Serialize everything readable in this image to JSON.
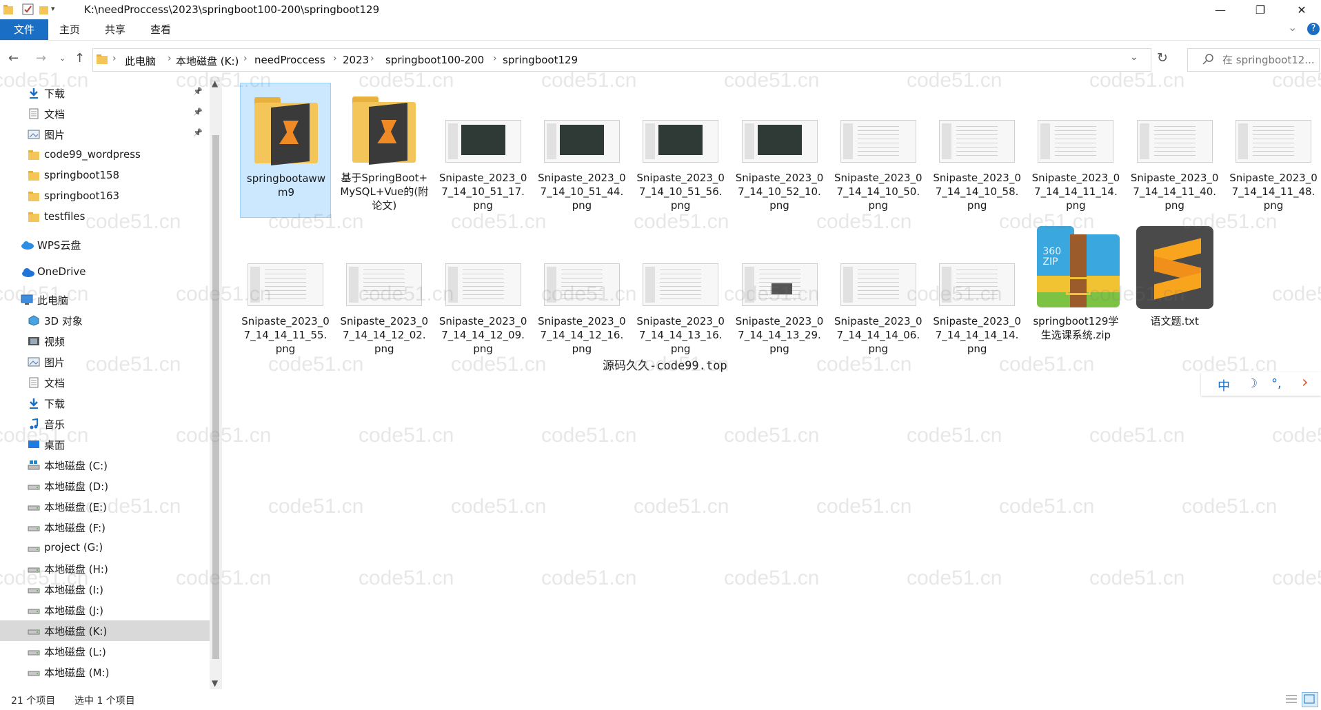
{
  "window": {
    "title": "K:\\needProccess\\2023\\springboot100-200\\springboot129",
    "minimize": "—",
    "restore": "❐",
    "close": "✕"
  },
  "ribbon": {
    "tabs": [
      "文件",
      "主页",
      "共享",
      "查看"
    ],
    "expand": "⌄",
    "help": "?"
  },
  "address": {
    "crumbs": [
      "此电脑",
      "本地磁盘 (K:)",
      "needProccess",
      "2023",
      "springboot100-200",
      "springboot129"
    ],
    "search_placeholder": "在 springboot12..."
  },
  "sidebar": {
    "items": [
      {
        "label": "下载",
        "icon": "download-icon",
        "pinned": true
      },
      {
        "label": "文档",
        "icon": "document-icon",
        "pinned": true
      },
      {
        "label": "图片",
        "icon": "picture-icon",
        "pinned": true
      },
      {
        "label": "code99_wordpress",
        "icon": "folder-icon"
      },
      {
        "label": "springboot158",
        "icon": "folder-icon"
      },
      {
        "label": "springboot163",
        "icon": "folder-icon"
      },
      {
        "label": "testfiles",
        "icon": "folder-icon"
      },
      {
        "label": "WPS云盘",
        "icon": "cloud-icon"
      },
      {
        "label": "OneDrive",
        "icon": "onedrive-icon"
      },
      {
        "label": "此电脑",
        "icon": "computer-icon"
      },
      {
        "label": "3D 对象",
        "icon": "cube-icon"
      },
      {
        "label": "视频",
        "icon": "video-icon"
      },
      {
        "label": "图片",
        "icon": "picture-icon"
      },
      {
        "label": "文档",
        "icon": "document-icon"
      },
      {
        "label": "下载",
        "icon": "download-icon"
      },
      {
        "label": "音乐",
        "icon": "music-icon"
      },
      {
        "label": "桌面",
        "icon": "desktop-icon"
      },
      {
        "label": "本地磁盘 (C:)",
        "icon": "system-drive-icon"
      },
      {
        "label": "本地磁盘 (D:)",
        "icon": "drive-icon"
      },
      {
        "label": "本地磁盘 (E:)",
        "icon": "drive-icon"
      },
      {
        "label": "本地磁盘 (F:)",
        "icon": "drive-icon"
      },
      {
        "label": "project (G:)",
        "icon": "drive-icon"
      },
      {
        "label": "本地磁盘 (H:)",
        "icon": "drive-icon"
      },
      {
        "label": "本地磁盘 (I:)",
        "icon": "drive-icon"
      },
      {
        "label": "本地磁盘 (J:)",
        "icon": "drive-icon"
      },
      {
        "label": "本地磁盘 (K:)",
        "icon": "drive-icon",
        "selected": true
      },
      {
        "label": "本地磁盘 (L:)",
        "icon": "drive-icon"
      },
      {
        "label": "本地磁盘 (M:)",
        "icon": "drive-icon"
      }
    ]
  },
  "files": [
    {
      "name": "springbootawwm9",
      "type": "folder",
      "selected": true
    },
    {
      "name": "基于SpringBoot+MySQL+Vue的(附论文)",
      "type": "folder"
    },
    {
      "name": "Snipaste_2023_07_14_10_51_17.png",
      "type": "shot-dark"
    },
    {
      "name": "Snipaste_2023_07_14_10_51_44.png",
      "type": "shot-dark"
    },
    {
      "name": "Snipaste_2023_07_14_10_51_56.png",
      "type": "shot-dark"
    },
    {
      "name": "Snipaste_2023_07_14_10_52_10.png",
      "type": "shot-dark"
    },
    {
      "name": "Snipaste_2023_07_14_14_10_50.png",
      "type": "shot-light"
    },
    {
      "name": "Snipaste_2023_07_14_14_10_58.png",
      "type": "shot-light"
    },
    {
      "name": "Snipaste_2023_07_14_14_11_14.png",
      "type": "shot-light"
    },
    {
      "name": "Snipaste_2023_07_14_14_11_40.png",
      "type": "shot-light"
    },
    {
      "name": "Snipaste_2023_07_14_14_11_48.png",
      "type": "shot-light"
    },
    {
      "name": "Snipaste_2023_07_14_14_11_55.png",
      "type": "shot-light"
    },
    {
      "name": "Snipaste_2023_07_14_14_12_02.png",
      "type": "shot-light"
    },
    {
      "name": "Snipaste_2023_07_14_14_12_09.png",
      "type": "shot-light"
    },
    {
      "name": "Snipaste_2023_07_14_14_12_16.png",
      "type": "shot-light"
    },
    {
      "name": "Snipaste_2023_07_14_14_13_16.png",
      "type": "shot-light"
    },
    {
      "name": "Snipaste_2023_07_14_14_13_29.png",
      "type": "shot-box"
    },
    {
      "name": "Snipaste_2023_07_14_14_14_06.png",
      "type": "shot-light"
    },
    {
      "name": "Snipaste_2023_07_14_14_14_14.png",
      "type": "shot-light"
    },
    {
      "name": "springboot129学生选课系统.zip",
      "type": "zip"
    },
    {
      "name": "语文题.txt",
      "type": "sublime"
    }
  ],
  "zip_logo_text": "360\nZIP",
  "overlay_text": "源码久久-code99.top",
  "watermark": "code51.cn",
  "ime": {
    "mode": "中",
    "moon": "☽",
    "punct": "°,",
    "arrow": "›"
  },
  "status": {
    "count": "21 个项目",
    "selection": "选中 1 个项目"
  },
  "colors": {
    "accent": "#1a6fc4",
    "selection": "#cce8ff",
    "folder": "#f4c558"
  }
}
